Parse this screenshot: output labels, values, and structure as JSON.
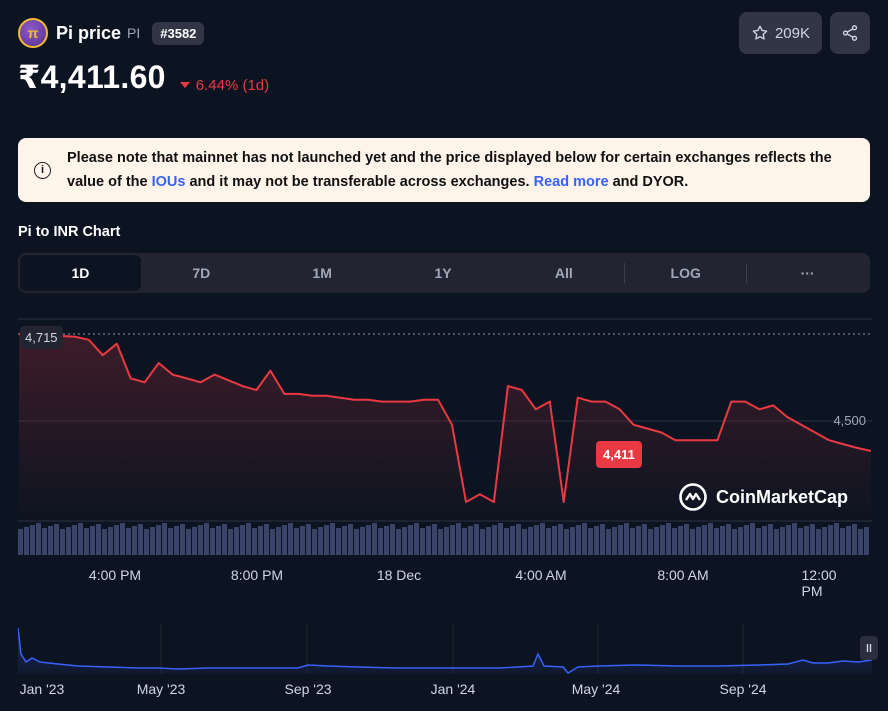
{
  "header": {
    "coin_logo_text": "π",
    "coin_name": "Pi price",
    "coin_symbol": "PI",
    "rank": "#3582",
    "watchlist_count": "209K"
  },
  "price": {
    "value": "₹4,411.60",
    "change": "6.44% (1d)",
    "change_color": "#ea3943"
  },
  "notice": {
    "text_before": "Please note that mainnet has not launched yet and the price displayed below for certain exchanges reflects the value of the ",
    "link1": "IOUs",
    "text_middle": " and it may not be transferable across exchanges. ",
    "link2": "Read more",
    "text_after": " and DYOR."
  },
  "chart_title": "Pi to INR Chart",
  "tabs": [
    "1D",
    "7D",
    "1M",
    "1Y",
    "All",
    "LOG",
    "···"
  ],
  "chart": {
    "label_top": "4,715",
    "label_mid": "4,500",
    "current_value": "4,411",
    "watermark": "CoinMarketCap",
    "time_labels": [
      "4:00 PM",
      "8:00 PM",
      "18 Dec",
      "4:00 AM",
      "8:00 AM",
      "12:00 PM"
    ]
  },
  "overview": {
    "labels": [
      "Jan '23",
      "May '23",
      "Sep '23",
      "Jan '24",
      "May '24",
      "Sep '24"
    ]
  },
  "colors": {
    "background": "#0d1421",
    "line": "#ea3943",
    "overview_line": "#3861fb",
    "volume": "#3a4368"
  },
  "chart_data": {
    "type": "line",
    "series": [
      {
        "values": [
          4715,
          4712,
          4712,
          4710,
          4708,
          4700,
          4660,
          4690,
          4600,
          4590,
          4640,
          4610,
          4600,
          4590,
          4610,
          4595,
          4580,
          4570,
          4620,
          4560,
          4560,
          4555,
          4555,
          4550,
          4545,
          4545,
          4540,
          4540,
          4540,
          4545,
          4545,
          4480,
          4280,
          4300,
          4280,
          4580,
          4570,
          4520,
          4540,
          4280,
          4550,
          4540,
          4540,
          4520,
          4480,
          4470,
          4460,
          4440,
          4440,
          4440,
          4440,
          4540,
          4540,
          4520,
          4530,
          4500,
          4480,
          4460,
          4440,
          4430,
          4420,
          4412
        ]
      }
    ],
    "ylim": [
      4280,
      4715
    ],
    "x_labels": [
      "4:00 PM",
      "8:00 PM",
      "18 Dec",
      "4:00 AM",
      "8:00 AM",
      "12:00 PM"
    ]
  }
}
